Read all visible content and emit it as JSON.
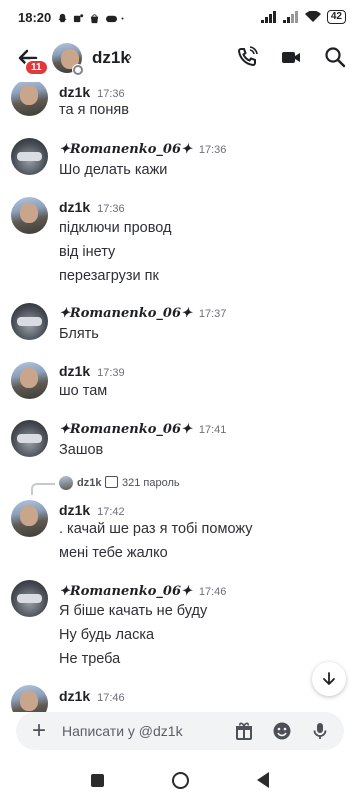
{
  "status_bar": {
    "time": "18:20",
    "battery": "42",
    "left_icons": [
      "snapchat-icon",
      "teams-icon",
      "shop-icon",
      "gamepad-icon",
      "dot-icon"
    ],
    "right_icons": [
      "signal-icon",
      "signal-icon",
      "wifi-icon",
      "battery-icon"
    ]
  },
  "header": {
    "unread_badge": "11",
    "username": "dz1k",
    "chevron": "›",
    "icons": [
      "phone-call-icon",
      "video-call-icon",
      "search-icon"
    ]
  },
  "messages": [
    {
      "author": "dz1k",
      "avatar": "dz1k",
      "time": "17:36",
      "lines": [
        "та я поняв"
      ]
    },
    {
      "author": "✦𝑹𝒐𝒎𝒂𝒏𝒆𝒏𝒌𝒐_06✦",
      "avatar": "romanenko",
      "time": "17:36",
      "lines": [
        "Шо делать кажи"
      ]
    },
    {
      "author": "dz1k",
      "avatar": "dz1k",
      "time": "17:36",
      "lines": [
        "підключи провод",
        "від інету",
        "перезагрузи пк"
      ]
    },
    {
      "author": "✦𝑹𝒐𝒎𝒂𝒏𝒆𝒏𝒌𝒐_06✦",
      "avatar": "romanenko",
      "time": "17:37",
      "lines": [
        "Блять"
      ]
    },
    {
      "author": "dz1k",
      "avatar": "dz1k",
      "time": "17:39",
      "lines": [
        "шо там"
      ]
    },
    {
      "author": "✦𝑹𝒐𝒎𝒂𝒏𝒆𝒏𝒌𝒐_06✦",
      "avatar": "romanenko",
      "time": "17:41",
      "lines": [
        "Зашов"
      ]
    },
    {
      "author": "dz1k",
      "avatar": "dz1k",
      "time": "17:42",
      "lines": [
        ". качай ше раз я тобі поможу",
        "мені тебе жалко"
      ]
    },
    {
      "author": "✦𝑹𝒐𝒎𝒂𝒏𝒆𝒏𝒌𝒐_06✦",
      "avatar": "romanenko",
      "time": "17:46",
      "lines": [
        "Я біше качать не буду",
        "Ну будь ласка",
        "Не треба"
      ]
    },
    {
      "author": "dz1k",
      "avatar": "dz1k",
      "time": "17:46",
      "lines": []
    }
  ],
  "reply_preview": {
    "author": "dz1k",
    "text": "321 пароль"
  },
  "composer": {
    "placeholder": "Написати у @dz1k",
    "icons": [
      "gift-icon",
      "emoji-icon",
      "microphone-icon"
    ]
  },
  "colors": {
    "badge": "#e0393c",
    "composer_bg": "#f2f3f5",
    "timestamp": "#6d6f78"
  }
}
